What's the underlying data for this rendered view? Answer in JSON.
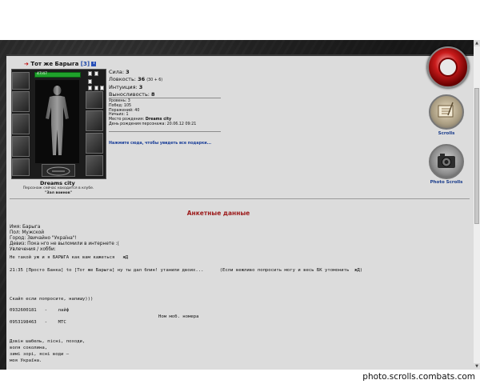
{
  "character": {
    "name": "Тот же Барыга",
    "level": "[3]",
    "hp": "47/47",
    "city": "Dreams city",
    "location_text": "Персонаж сейчас находится в клубе.",
    "location_room": "\"Зал воинов\""
  },
  "stats": {
    "strength_label": "Сила:",
    "strength": "3",
    "agility_label": "Ловкость:",
    "agility": "36",
    "agility_bonus": "(30 + 6)",
    "intuition_label": "Интуиция:",
    "intuition": "3",
    "stamina_label": "Выносливость:",
    "stamina": "8"
  },
  "info": {
    "level_line": "Уровень: 3",
    "wins_line": "Побед: 105",
    "losses_line": "Поражений: 40",
    "draws_line": "Ничьих: 1",
    "birthplace_label": "Место рождения:",
    "birthplace_value": "Dreams city",
    "birthday_line": "День рождения персонажа: 20.06.12 09:21"
  },
  "gifts_link": "Нажмите сюда, чтобы увидеть все подарки...",
  "sidebar": {
    "scrolls_label": "Scrolls",
    "photo_scrolls_label": "Photo Scrolls"
  },
  "anketa": {
    "title": "Анкетные данные",
    "name_line": "Имя: Барыга",
    "gender_line": "Пол: Мужской",
    "city_line": "Город: Звичайно \"Україна\"!",
    "motto_line": "Девиз: Пока нго не выломили в интернете :(",
    "hobbies_line": "Увлечения / хобби:",
    "hobbies_text": "Не такой уж и я БАРЫГА как вам кажеться   жД",
    "chat_line": "21:35 [Просто Банка] to [Тот же Барыга] ну ты дал блин! утанили двоих...      (Если вежливо попросить могу и весь БК утомонить  жД)",
    "request_line": "Скайп если попросите, напишу)))",
    "phone1": "0932600181   -    лайф",
    "phone_caption": "Ном моб. номера",
    "phone2": "0953198463   -    МТС",
    "poem1": "Дзвін шабель, пісні, походи,",
    "poem2": "воля соколина,",
    "poem3": "зимі зорі, ясні води —",
    "poem4": "моя Україна."
  },
  "watermark": "photo.scrolls.combats.com"
}
